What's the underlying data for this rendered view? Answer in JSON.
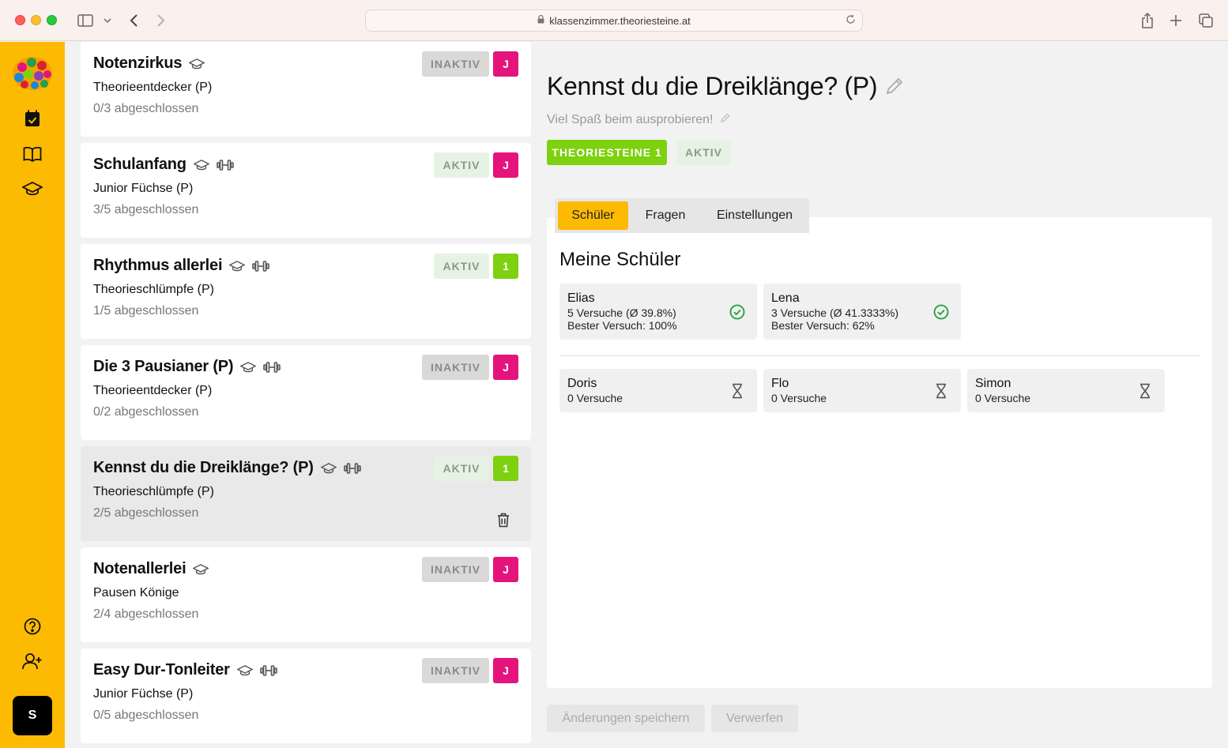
{
  "browser": {
    "url": "klassenzimmer.theoriesteine.at"
  },
  "sidebar": {
    "icons": [
      "logo",
      "calendar-check-icon",
      "book-open-icon",
      "graduation-cap-icon",
      "help-circle-icon",
      "user-plus-icon"
    ],
    "avatar_label": "S",
    "brand_color": "#fdba03"
  },
  "cards": [
    {
      "title": "Notenzirkus",
      "group": "Theorieentdecker (P)",
      "progress": "0/3 abgeschlossen",
      "status": "INAKTIV",
      "tag": "J",
      "icons": [
        "graduation-cap-icon"
      ]
    },
    {
      "title": "Schulanfang",
      "group": "Junior Füchse (P)",
      "progress": "3/5 abgeschlossen",
      "status": "AKTIV",
      "tag": "J",
      "icons": [
        "graduation-cap-icon",
        "dumbbell-icon"
      ]
    },
    {
      "title": "Rhythmus allerlei",
      "group": "Theorieschlümpfe (P)",
      "progress": "1/5 abgeschlossen",
      "status": "AKTIV",
      "tag": "1",
      "icons": [
        "graduation-cap-icon",
        "dumbbell-icon"
      ]
    },
    {
      "title": "Die 3 Pausianer (P)",
      "group": "Theorieentdecker (P)",
      "progress": "0/2 abgeschlossen",
      "status": "INAKTIV",
      "tag": "J",
      "icons": [
        "graduation-cap-icon",
        "dumbbell-icon"
      ]
    },
    {
      "title": "Kennst du die Dreiklänge? (P)",
      "group": "Theorieschlümpfe (P)",
      "progress": "2/5 abgeschlossen",
      "status": "AKTIV",
      "tag": "1",
      "icons": [
        "graduation-cap-icon",
        "dumbbell-icon"
      ],
      "selected": true
    },
    {
      "title": "Notenallerlei",
      "group": "Pausen Könige",
      "progress": "2/4 abgeschlossen",
      "status": "INAKTIV",
      "tag": "J",
      "icons": [
        "graduation-cap-icon"
      ]
    },
    {
      "title": "Easy Dur-Tonleiter",
      "group": "Junior Füchse (P)",
      "progress": "0/5 abgeschlossen",
      "status": "INAKTIV",
      "tag": "J",
      "icons": [
        "graduation-cap-icon",
        "dumbbell-icon"
      ]
    }
  ],
  "detail": {
    "title": "Kennst du die Dreiklänge? (P)",
    "subtitle": "Viel Spaß beim ausprobieren!",
    "group_pill": "THEORIESTEINE 1",
    "status_pill": "AKTIV",
    "tabs": [
      "Schüler",
      "Fragen",
      "Einstellungen"
    ],
    "active_tab": "Schüler",
    "section_title": "Meine Schüler",
    "completed_students": [
      {
        "name": "Elias",
        "attempts": "5 Versuche (Ø 39.8%)",
        "best": "Bester Versuch: 100%",
        "icon": "check-circle-icon"
      },
      {
        "name": "Lena",
        "attempts": "3 Versuche (Ø 41.3333%)",
        "best": "Bester Versuch: 62%",
        "icon": "check-circle-icon"
      }
    ],
    "pending_students": [
      {
        "name": "Doris",
        "attempts": "0 Versuche",
        "icon": "hourglass-icon"
      },
      {
        "name": "Flo",
        "attempts": "0 Versuche",
        "icon": "hourglass-icon"
      },
      {
        "name": "Simon",
        "attempts": "0 Versuche",
        "icon": "hourglass-icon"
      }
    ],
    "save_label": "Änderungen speichern",
    "discard_label": "Verwerfen"
  },
  "colors": {
    "accent_yellow": "#fdba03",
    "tag_pink": "#e5137c",
    "tag_green": "#7dd10e",
    "check_green": "#1e9e3a"
  }
}
